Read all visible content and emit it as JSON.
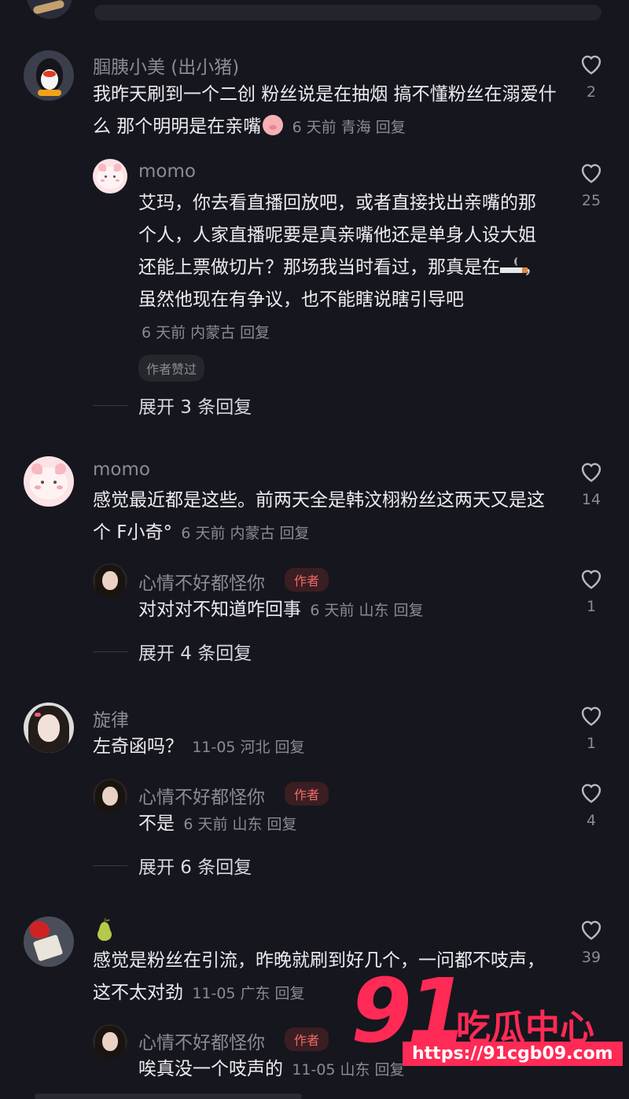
{
  "comments": {
    "c1": {
      "author": "腘胰小美 (出小猪)",
      "text": "我昨天刷到一个二创 粉丝说是在抽烟 搞不懂粉丝在溺爱什么 那个明明是在亲嘴",
      "time": "6 天前",
      "location": "青海",
      "reply": "回复",
      "likes": "2",
      "replies": [
        {
          "author": "momo",
          "text": "艾玛，你去看直播回放吧，或者直接找出亲嘴的那个人，人家直播呢要是真亲嘴他还是单身人设大姐还能上票做切片？那场我当时看过，那真是在",
          "text_end": "，虽然他现在有争议，也不能瞎说瞎引导吧",
          "time": "6 天前",
          "location": "内蒙古",
          "reply": "回复",
          "likes": "25",
          "badge": "作者赞过"
        }
      ],
      "expand": "展开 3 条回复"
    },
    "c2": {
      "author": "momo",
      "text": "感觉最近都是这些。前两天全是韩汶栩粉丝这两天又是这个 F小奇°",
      "time": "6 天前",
      "location": "内蒙古",
      "reply": "回复",
      "likes": "14",
      "replies": [
        {
          "author": "心情不好都怪你",
          "author_tag": "作者",
          "text": "对对对不知道咋回事",
          "time": "6 天前",
          "location": "山东",
          "reply": "回复",
          "likes": "1"
        }
      ],
      "expand": "展开 4 条回复"
    },
    "c3": {
      "author": "旋律",
      "text": "左奇函吗？",
      "time": "11-05",
      "location": "河北",
      "reply": "回复",
      "likes": "1",
      "replies": [
        {
          "author": "心情不好都怪你",
          "author_tag": "作者",
          "text": "不是",
          "time": "6 天前",
          "location": "山东",
          "reply": "回复",
          "likes": "4"
        }
      ],
      "expand": "展开 6 条回复"
    },
    "c4": {
      "author_icon": "pear-emoji-icon",
      "text": "感觉是粉丝在引流，昨晚就刷到好几个，一问都不吱声，这不太对劲",
      "time": "11-05",
      "location": "广东",
      "reply": "回复",
      "likes": "39",
      "replies": [
        {
          "author": "心情不好都怪你",
          "author_tag": "作者",
          "text": "唉真没一个吱声的",
          "time": "11-05",
          "location": "山东",
          "reply": "回复"
        }
      ]
    }
  },
  "watermark": {
    "number": "91",
    "site_name": "吃瓜中心",
    "url": "https://91cgb09.com"
  },
  "colors": {
    "background": "#16161e",
    "author_tag": "#f06a6a",
    "watermark": "#ff2a55"
  }
}
